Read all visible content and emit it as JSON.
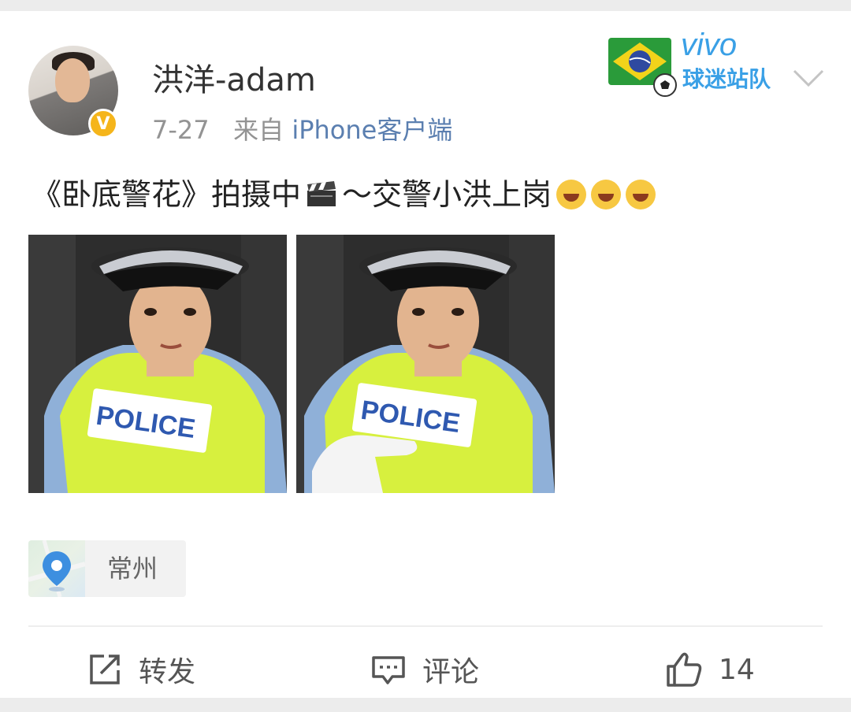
{
  "post": {
    "username": "洪洋-adam",
    "date": "7-27",
    "source_prefix": "来自",
    "source": "iPhone客户端",
    "text_part1": "《卧底警花》拍摄中",
    "text_part2": "～交警小洪上岗",
    "location": "常州",
    "photos": [
      {
        "vest_text": "POLICE"
      },
      {
        "vest_text": "POLICE"
      }
    ]
  },
  "badge": {
    "brand": "vivo",
    "caption": "球迷站队"
  },
  "actions": {
    "repost_label": "转发",
    "comment_label": "评论",
    "like_count": "14"
  },
  "colors": {
    "background": "#ececec",
    "card": "#ffffff",
    "source_link": "#5b7fb0",
    "verified": "#f5b51b",
    "vivo_blue": "#3aa0e6",
    "vest_yellow": "#d7f03e"
  },
  "icons": [
    "verified-icon",
    "chevron-down-icon",
    "clapperboard-icon",
    "laugh-cry-emoji-icon",
    "location-pin-icon",
    "repost-icon",
    "comment-icon",
    "like-icon",
    "brazil-flag-icon",
    "soccer-ball-icon"
  ]
}
